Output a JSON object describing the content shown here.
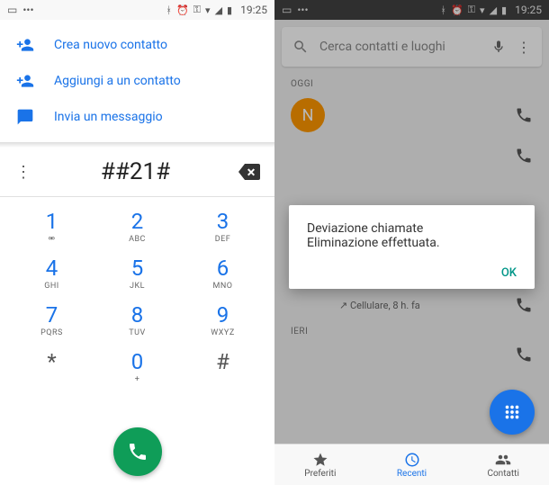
{
  "status": {
    "time": "19:25"
  },
  "left": {
    "actions": {
      "create": "Crea nuovo contatto",
      "add": "Aggiungi a un contatto",
      "message": "Invia un messaggio"
    },
    "dialed": "##21#",
    "keypad": [
      {
        "d": "1",
        "s": "⚮"
      },
      {
        "d": "2",
        "s": "ABC"
      },
      {
        "d": "3",
        "s": "DEF"
      },
      {
        "d": "4",
        "s": "GHI"
      },
      {
        "d": "5",
        "s": "JKL"
      },
      {
        "d": "6",
        "s": "MNO"
      },
      {
        "d": "7",
        "s": "PQRS"
      },
      {
        "d": "8",
        "s": "TUV"
      },
      {
        "d": "9",
        "s": "WXYZ"
      },
      {
        "d": "*",
        "s": ""
      },
      {
        "d": "0",
        "s": "+"
      },
      {
        "d": "#",
        "s": ""
      }
    ]
  },
  "right": {
    "search_placeholder": "Cerca contatti e luoghi",
    "sections": {
      "today": "OGGI",
      "yesterday": "IERI"
    },
    "avatar_letter": "N",
    "call_sub": "Cellulare, 8 h. fa",
    "dialog": {
      "line1": "Deviazione chiamate",
      "line2": "Eliminazione effettuata.",
      "ok": "OK"
    },
    "nav": {
      "fav": "Preferiti",
      "recent": "Recenti",
      "contacts": "Contatti"
    }
  }
}
